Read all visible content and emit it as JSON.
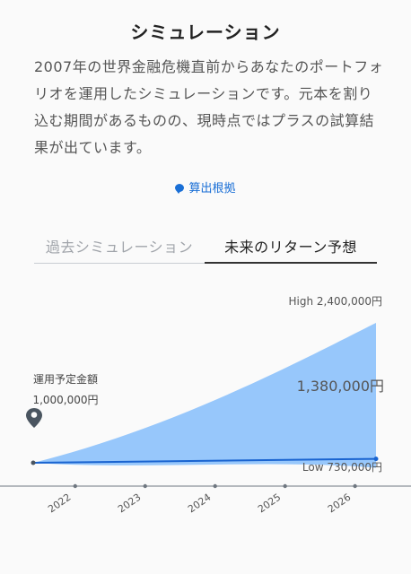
{
  "header": {
    "title": "シミュレーション"
  },
  "description": "2007年の世界金融危機直前からあなたのポートフォリオを運用したシミュレーションです。元本を割り込む期間があるものの、現時点ではプラスの試算結果が出ています。",
  "basis_link": {
    "label": "算出根拠",
    "icon": "speech-bubble-icon"
  },
  "tabs": [
    {
      "label": "過去シミュレーション",
      "active": false
    },
    {
      "label": "未来のリターン予想",
      "active": true
    }
  ],
  "colors": {
    "band_fill": "#97c7fb",
    "median_line": "#1a64d0",
    "link": "#1a6fd6",
    "axis": "#6f7780"
  },
  "chart_data": {
    "type": "area",
    "x": [
      "start",
      "2022",
      "2023",
      "2024",
      "2025",
      "2026",
      "end"
    ],
    "x_tick_labels": [
      "2022",
      "2023",
      "2024",
      "2025",
      "2026"
    ],
    "x_tick_values": [
      2022,
      2023,
      2024,
      2025,
      2026
    ],
    "x_start": 2021.4,
    "x_end": 2026.3,
    "start_value": 1000000,
    "high_value": 2400000,
    "median_value": 1380000,
    "low_value": 730000,
    "start_label": "運用予定金額",
    "start_amount_label": "1,000,000円",
    "high_label": "High 2,400,000円",
    "median_label": "1,380,000円",
    "low_label": "Low 730,000円",
    "ylim": [
      500000,
      2500000
    ],
    "marker_icon": "map-pin-icon"
  }
}
